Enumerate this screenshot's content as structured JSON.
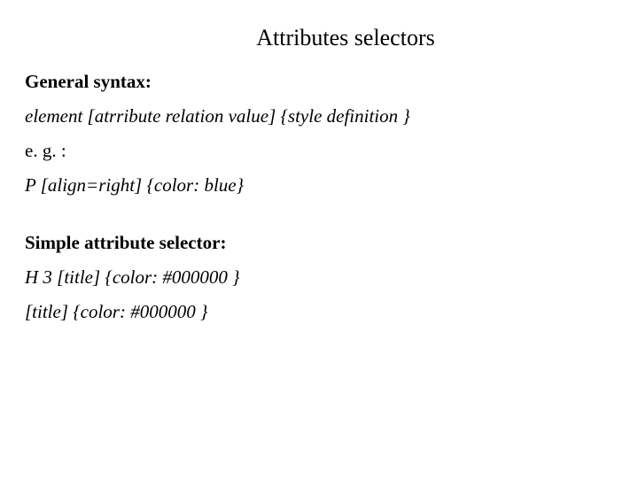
{
  "title": "Attributes selectors",
  "section1": {
    "label": "General syntax:",
    "syntax": "element [atrribute relation value] {style  definition }",
    "eg_label": "e. g. :",
    "example": "P [align=right] {color: blue}"
  },
  "section2": {
    "label": "Simple attribute selector:",
    "example1": "H 3 [title] {color: #000000 }",
    "example2": "[title] {color: #000000 }"
  }
}
